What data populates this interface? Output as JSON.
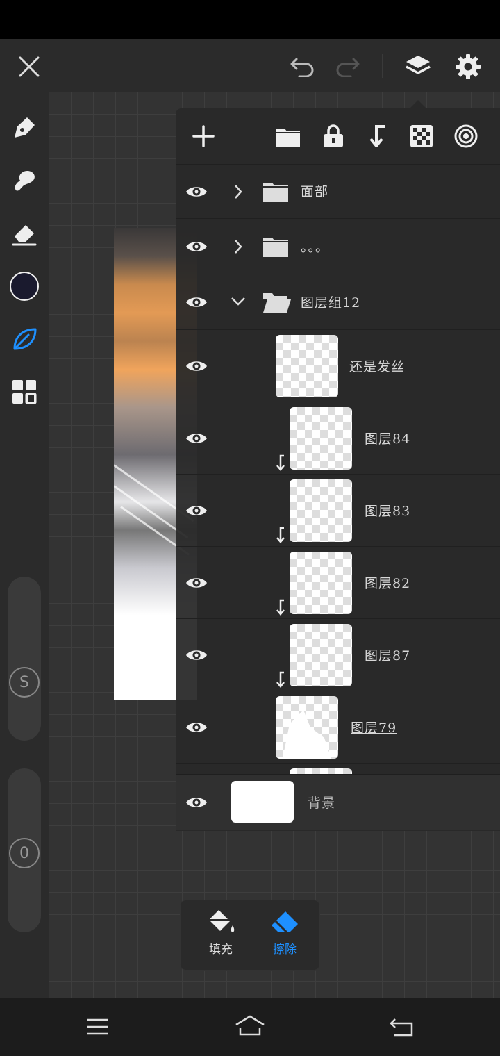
{
  "toolbar": {
    "close_icon": "close-icon",
    "undo_icon": "undo-icon",
    "redo_icon": "redo-icon",
    "layers_icon": "layers-icon",
    "settings_icon": "gear-icon"
  },
  "sidebar": {
    "tools": [
      "pen-tool-icon",
      "smudge-tool-icon",
      "eraser-tool-icon",
      "color-swatch",
      "brush-leaf-icon",
      "grid-menu-icon"
    ],
    "active_color": "#1a1a2e",
    "active_tool_color": "#1e90ff",
    "size_slider_label": "S",
    "opacity_slider_label": "0"
  },
  "layers_panel": {
    "toolbar_icons": [
      "add-layer-icon",
      "folder-icon",
      "lock-icon",
      "clip-down-icon",
      "checker-icon",
      "target-icon"
    ],
    "layers": [
      {
        "name": "面部",
        "type": "group",
        "expanded": false
      },
      {
        "name": "。。。",
        "type": "group",
        "expanded": false
      },
      {
        "name": "图层组12",
        "type": "group",
        "expanded": true
      },
      {
        "name": "还是发丝",
        "type": "layer",
        "clipped": false
      },
      {
        "name": "图层84",
        "type": "layer",
        "clipped": true
      },
      {
        "name": "图层83",
        "type": "layer",
        "clipped": true
      },
      {
        "name": "图层82",
        "type": "layer",
        "clipped": true
      },
      {
        "name": "图层87",
        "type": "layer",
        "clipped": true
      },
      {
        "name": "图层79",
        "type": "layer",
        "clipped": false,
        "underlined": true
      }
    ],
    "background_layer": {
      "name": "背景"
    }
  },
  "fill_erase": {
    "fill_label": "填充",
    "erase_label": "擦除",
    "active": "erase",
    "active_color": "#1e90ff"
  },
  "navbar": {
    "icons": [
      "menu-icon",
      "home-icon",
      "back-icon"
    ]
  }
}
